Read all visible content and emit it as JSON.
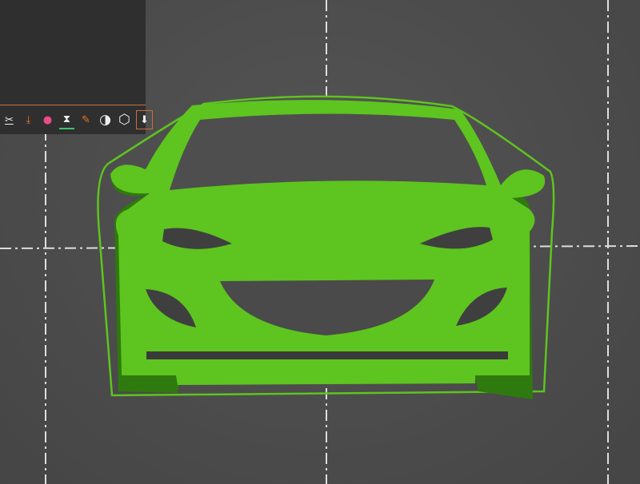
{
  "toolbar": {
    "items": [
      {
        "icon": "cut-icon",
        "glyph": "✂"
      },
      {
        "icon": "support-paint-icon",
        "glyph": "⤓"
      },
      {
        "icon": "color-paint-icon",
        "glyph": "●"
      },
      {
        "icon": "variable-layer-height-icon",
        "glyph": "⧗"
      },
      {
        "icon": "seam-paint-icon",
        "glyph": "✎"
      },
      {
        "icon": "measure-icon",
        "glyph": "◑"
      },
      {
        "icon": "view-cube-icon",
        "glyph": "⬡"
      },
      {
        "icon": "drop-to-bed-icon",
        "glyph": "⬇"
      }
    ]
  },
  "colors": {
    "model": "#5ec41f",
    "model_dark": "#2e7a0e",
    "brim": "#5ec41f",
    "background": "#4a4a4a",
    "accent": "#c8703a"
  }
}
